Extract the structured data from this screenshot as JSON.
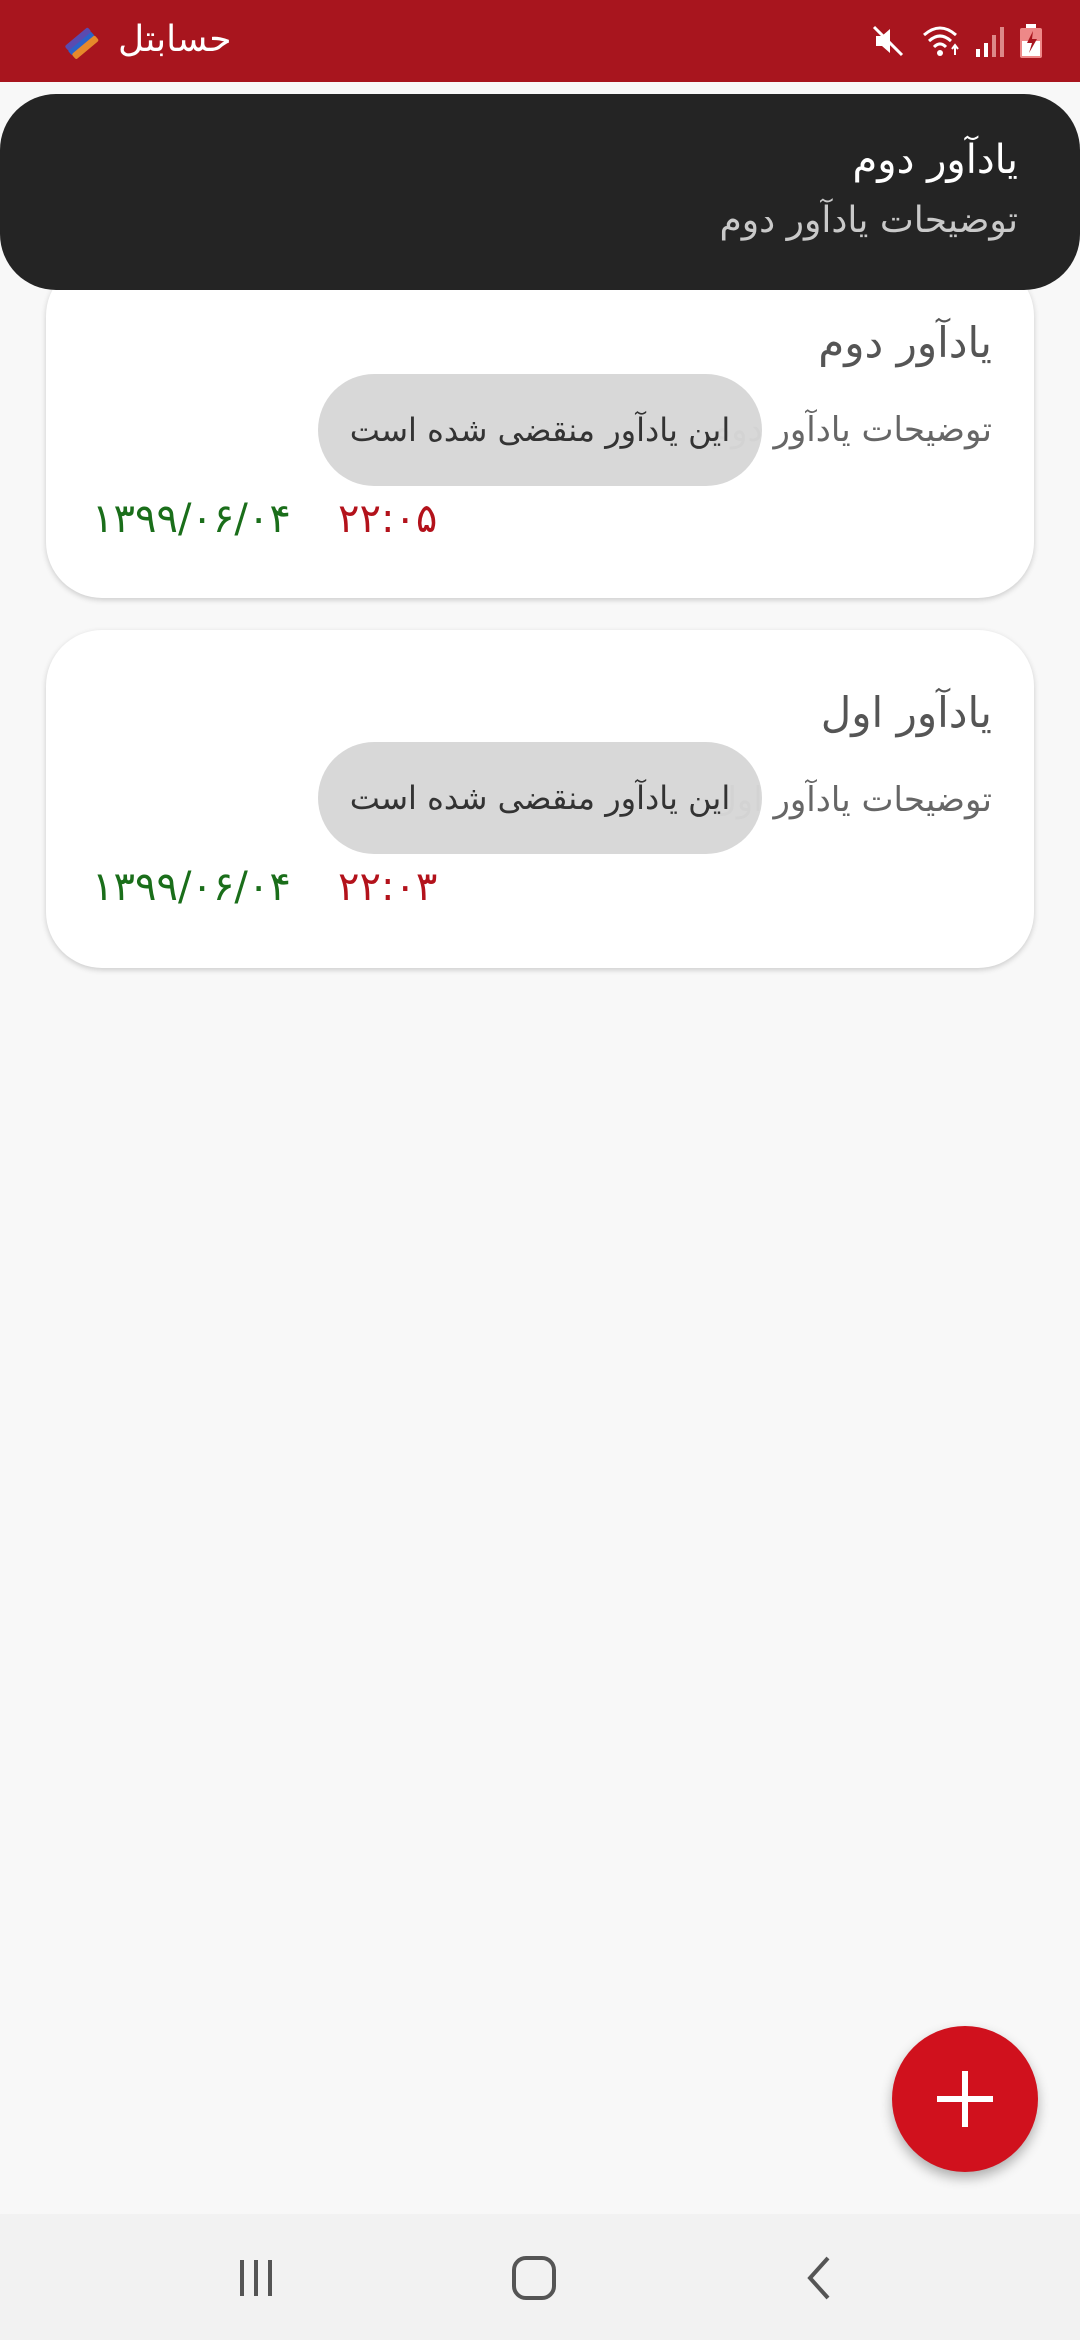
{
  "status_bar": {
    "app_title": "حسابتل",
    "icons": [
      "mute-icon",
      "wifi-icon",
      "signal-icon",
      "battery-charging-icon"
    ],
    "color": "#a8151e"
  },
  "notification": {
    "title": "یادآور دوم",
    "body": "توضیحات یادآور دوم"
  },
  "reminders": [
    {
      "title": "یادآور دوم",
      "description": "توضیحات یادآور دوم",
      "time": "۲۲:۰۵",
      "date": "۱۳۹۹/۰۶/۰۴",
      "toast": "این یادآور منقضی شده است"
    },
    {
      "title": "یادآور اول",
      "description": "توضیحات یادآور اول",
      "time": "۲۲:۰۳",
      "date": "۱۳۹۹/۰۶/۰۴",
      "toast": "این یادآور منقضی شده است"
    }
  ],
  "fab": {
    "icon": "plus-icon",
    "color": "#d0111d"
  },
  "nav_bar": {
    "icons": [
      "recent-apps-icon",
      "home-icon",
      "back-icon"
    ]
  },
  "colors": {
    "time": "#b3121b",
    "date": "#1a6e1a"
  }
}
